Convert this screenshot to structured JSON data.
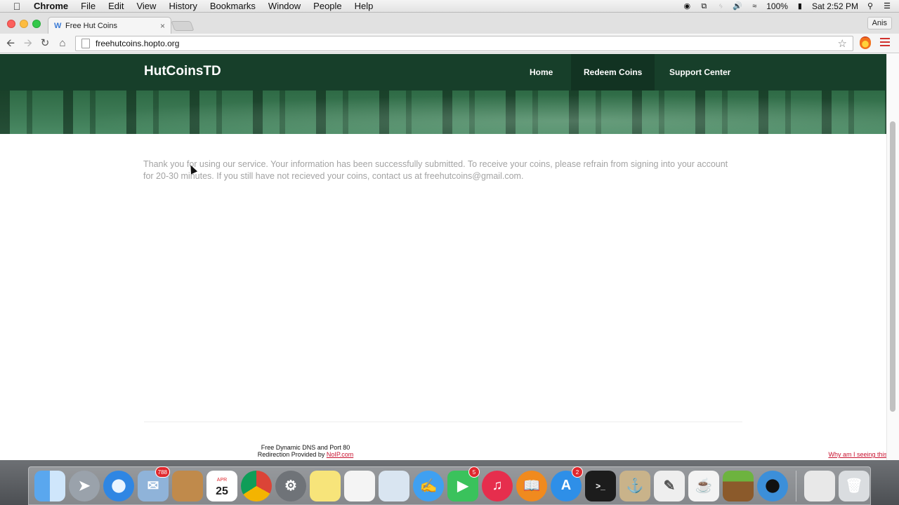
{
  "menubar": {
    "app_name": "Chrome",
    "menus": [
      "File",
      "Edit",
      "View",
      "History",
      "Bookmarks",
      "Window",
      "People",
      "Help"
    ],
    "battery": "100%",
    "clock": "Sat 2:52 PM"
  },
  "browser": {
    "tab_title": "Free Hut Coins",
    "tab_close": "×",
    "profile_name": "Anis",
    "url": "freehutcoins.hopto.org"
  },
  "site": {
    "brand": "HutCoinsTD",
    "nav": {
      "home": "Home",
      "redeem": "Redeem Coins",
      "support": "Support Center"
    },
    "message": "Thank you for using our service. Your information has been successfully submitted. To receive your coins, please refrain from signing into your account for 20-30 minutes. If you still have not recieved your coins, contact us at freehutcoins@gmail.com.",
    "noip_line1": "Free Dynamic DNS and Port 80",
    "noip_line2_prefix": "Redirection Provided by",
    "noip_link": "NoIP.com",
    "why_link": "Why am I seeing this?"
  },
  "dock": {
    "badges": {
      "mail": "788",
      "calendar_month": "APR",
      "calendar_day": "25",
      "facetime": "5",
      "appstore": "2"
    }
  },
  "colors": {
    "nav_bg": "#173f2a",
    "message_text": "#a3a3a3",
    "link_red": "#c8102e"
  }
}
